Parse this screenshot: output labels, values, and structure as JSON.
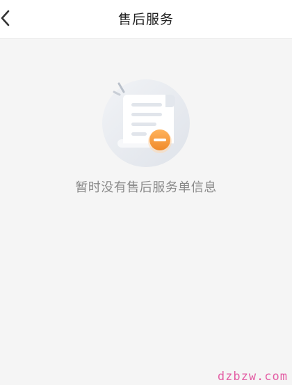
{
  "header": {
    "title": "售后服务",
    "back_icon": "chevron-left-icon"
  },
  "empty_state": {
    "icon": "empty-document-minus-icon",
    "message": "暂时没有售后服务单信息"
  },
  "watermark": {
    "text": "dzbzw.com"
  },
  "colors": {
    "background": "#f5f5f5",
    "header_bg": "#ffffff",
    "accent_orange": "#f7953b",
    "text_gray": "#8a8a8a"
  }
}
